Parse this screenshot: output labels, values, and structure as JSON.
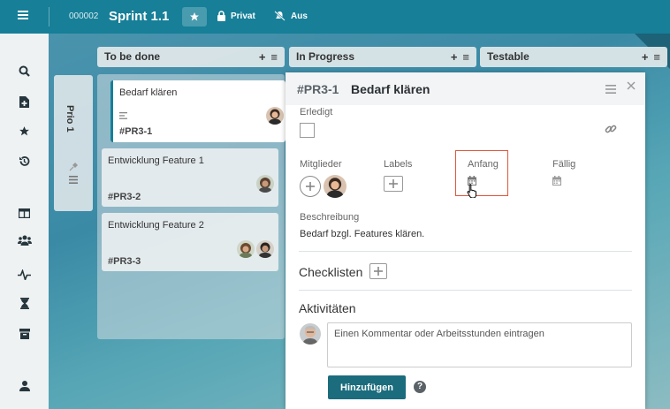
{
  "topbar": {
    "sprint_id": "000002",
    "sprint_title": "Sprint 1.1",
    "privacy_label": "Privat",
    "notifications_label": "Aus",
    "icons": [
      "menu-icon",
      "star-icon",
      "lock-icon",
      "bell-off-icon"
    ]
  },
  "sidebar": {
    "icons": [
      "search-icon",
      "new-document-icon",
      "star-icon",
      "history-icon",
      "board-icon",
      "team-icon",
      "activity-icon",
      "hourglass-icon",
      "archive-icon",
      "user-icon"
    ]
  },
  "board": {
    "lanes": [
      {
        "title": "To be done",
        "add": "+",
        "menu": "≡"
      },
      {
        "title": "In Progress",
        "add": "+",
        "menu": "≡"
      },
      {
        "title": "Testable",
        "add": "+",
        "menu": "≡"
      }
    ],
    "swimlane": {
      "label": "Prio 1"
    },
    "cards": [
      {
        "title": "Bedarf klären",
        "id": "#PR3-1"
      },
      {
        "title": "Entwicklung Feature 1",
        "id": "#PR3-2"
      },
      {
        "title": "Entwicklung Feature 2",
        "id": "#PR3-3"
      }
    ]
  },
  "detail": {
    "id": "#PR3-1",
    "title": "Bedarf klären",
    "done_label": "Erledigt",
    "members_label": "Mitglieder",
    "labels_label": "Labels",
    "start_label": "Anfang",
    "due_label": "Fällig",
    "description_label": "Beschreibung",
    "description_text": "Bedarf bzgl. Features klären.",
    "checklists_label": "Checklisten",
    "activities_label": "Aktivitäten",
    "comment_placeholder": "Einen Kommentar oder Arbeitsstunden eintragen",
    "submit_label": "Hinzufügen",
    "help_label": "?"
  },
  "colors": {
    "topbar": "#177f98",
    "sidebar": "#eef2f3",
    "submit_button": "#1b6c7d",
    "highlight": "#e0563c"
  }
}
